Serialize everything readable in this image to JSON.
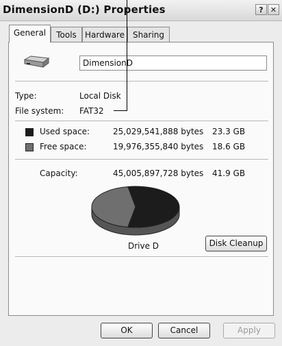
{
  "window": {
    "title": "DimensionD (D:) Properties",
    "help_glyph": "?",
    "close_glyph": "✕"
  },
  "tabs": [
    {
      "label": "General",
      "active": true
    },
    {
      "label": "Tools"
    },
    {
      "label": "Hardware"
    },
    {
      "label": "Sharing"
    }
  ],
  "general": {
    "drive_icon": "drive-icon",
    "volume_name": "DimensionD",
    "type_label": "Type:",
    "type_value": "Local Disk",
    "fs_label": "File system:",
    "fs_value": "FAT32",
    "used": {
      "label": "Used space:",
      "bytes": "25,029,541,888 bytes",
      "size": "23.3 GB",
      "color": "#1c1c1c"
    },
    "free": {
      "label": "Free space:",
      "bytes": "19,976,355,840 bytes",
      "size": "18.6 GB",
      "color": "#6f6f6f"
    },
    "capacity": {
      "label": "Capacity:",
      "bytes": "45,005,897,728 bytes",
      "size": "41.9 GB"
    },
    "used_fraction": 0.556,
    "drive_label": "Drive D",
    "disk_cleanup": "Disk Cleanup"
  },
  "buttons": {
    "ok": "OK",
    "cancel": "Cancel",
    "apply": "Apply"
  }
}
